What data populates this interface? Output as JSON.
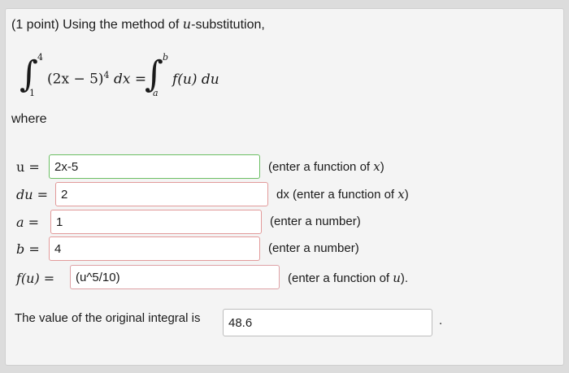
{
  "question": {
    "points": "(1 point)",
    "prompt_prefix": "Using the method of ",
    "prompt_var": "u",
    "prompt_suffix": "-substitution,"
  },
  "integral": {
    "lower_left": "1",
    "upper_left": "4",
    "integrand": "(2x − 5)",
    "exponent": "4",
    "dx": "dx",
    "equals": "=",
    "lower_right": "a",
    "upper_right": "b",
    "right_integrand": "f(u) du"
  },
  "where_label": "where",
  "rows": [
    {
      "label": "u =",
      "value": "2x-5",
      "hint_prefix": "(enter a function of ",
      "hint_var": "x",
      "hint_suffix": ")",
      "status": "green"
    },
    {
      "label": "du =",
      "value": "2",
      "hint_prefix": "dx (enter a function of ",
      "hint_var": "x",
      "hint_suffix": ")",
      "status": "red"
    },
    {
      "label": "a =",
      "value": "1",
      "hint_prefix": "(enter a number)",
      "hint_var": "",
      "hint_suffix": "",
      "status": "red"
    },
    {
      "label": "b =",
      "value": "4",
      "hint_prefix": "(enter a number)",
      "hint_var": "",
      "hint_suffix": "",
      "status": "red"
    },
    {
      "label": "f(u) =",
      "value": "(u^5/10)",
      "hint_prefix": "(enter a function of ",
      "hint_var": "u",
      "hint_suffix": ").",
      "status": "pink"
    }
  ],
  "final": {
    "label": "The value of the original integral is",
    "value": "48.6",
    "trailing": "."
  },
  "colors": {
    "correct_border": "#6bbf63",
    "incorrect_border": "#e29a9a",
    "panel_bg": "#f4f4f4",
    "page_bg": "#dcdcdc"
  }
}
